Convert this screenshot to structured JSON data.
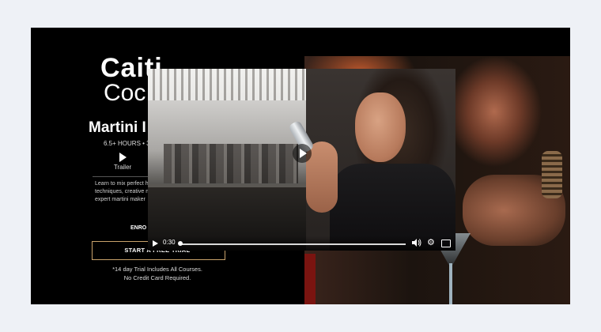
{
  "course": {
    "logo_line1": "Caiti",
    "logo_line2": "Coc",
    "title": "Martini I",
    "meta": "6.5+ HOURS • 3",
    "trailer_label": "Trailer",
    "description": "Learn to mix perfect history, techniques, creative martini cocl expert martini maker",
    "enroll": "ENRO",
    "trial_button": "START A FREE TRIAL*",
    "note_line1": "*14 day Trial Includes All Courses.",
    "note_line2": "No Credit Card Required."
  },
  "player": {
    "time": "0:30",
    "progress_fraction": 0.0,
    "icons": {
      "play": "play-icon",
      "volume": "volume-icon",
      "settings": "gear-icon",
      "fullscreen": "fullscreen-icon"
    }
  },
  "colors": {
    "page_background": "#eef1f6",
    "panel_background": "#000000",
    "trial_button_border": "#c8a26b"
  }
}
